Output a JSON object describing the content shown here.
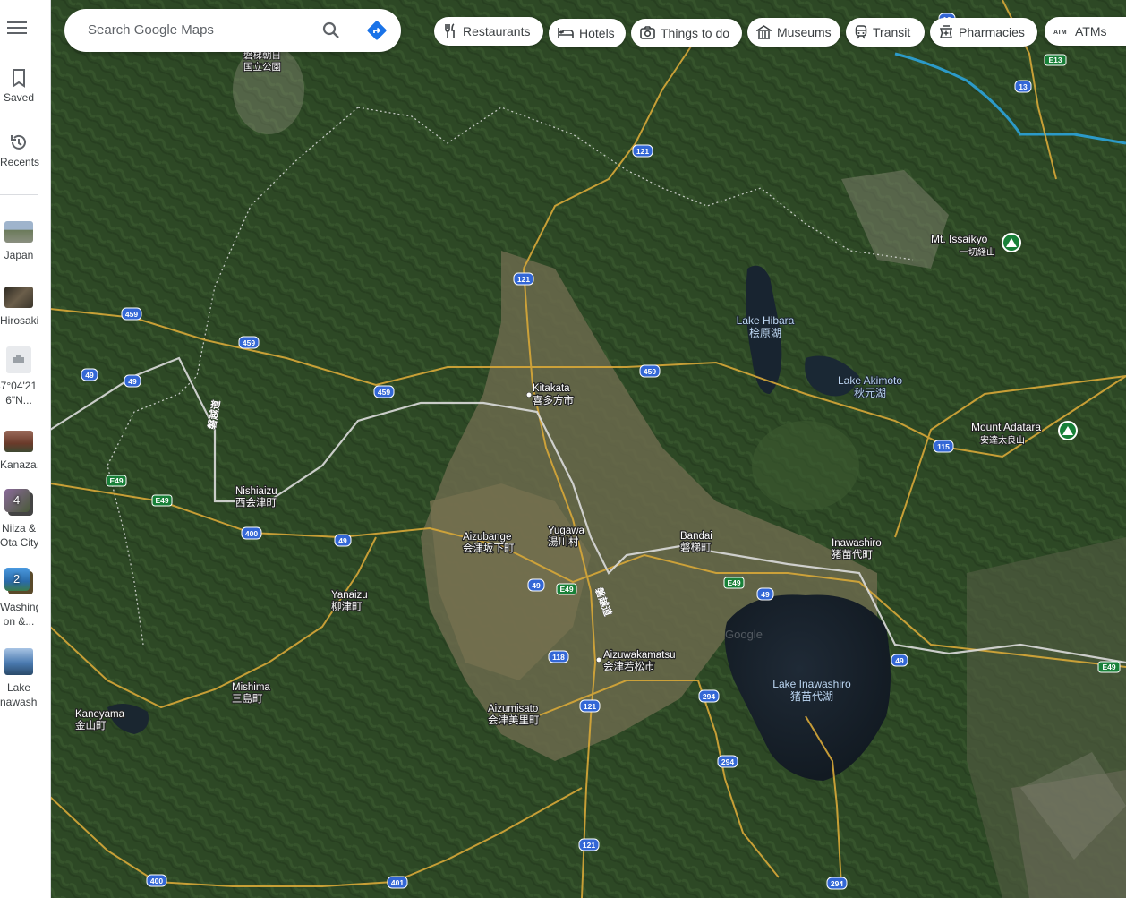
{
  "search": {
    "placeholder": "Search Google Maps"
  },
  "rail": {
    "saved_label": "Saved",
    "recents_label": "Recents",
    "items": [
      {
        "label": "Japan",
        "color": "#7a8fa8"
      },
      {
        "label": "Hirosaki",
        "color": "#4a4034"
      },
      {
        "label": "37°04'21.6\"N...",
        "line1": "37°04'21.",
        "line2": "6\"N..."
      },
      {
        "label": "Kanaza...",
        "color": "#7a4a3a"
      },
      {
        "label": "Niiza & Ota City",
        "line1": "Niiza &",
        "line2": "Ota City",
        "count": "4",
        "color": "#6a5a7a"
      },
      {
        "label": "Washington &...",
        "line1": "Washingt",
        "line2": "on &...",
        "count": "2",
        "color": "#3a7ab8"
      },
      {
        "label": "Lake Inawash...",
        "line1": "Lake",
        "line2": "nawash...",
        "color": "#5a88b8"
      }
    ]
  },
  "chips": [
    {
      "label": "Restaurants",
      "icon": "fork-knife-icon"
    },
    {
      "label": "Hotels",
      "icon": "bed-icon"
    },
    {
      "label": "Things to do",
      "icon": "camera-icon"
    },
    {
      "label": "Museums",
      "icon": "museum-icon"
    },
    {
      "label": "Transit",
      "icon": "train-icon"
    },
    {
      "label": "Pharmacies",
      "icon": "pharmacy-icon"
    },
    {
      "label": "ATMs",
      "icon": "atm-icon"
    }
  ],
  "map": {
    "places": [
      {
        "en": "Kitakata",
        "ja": "喜多方市"
      },
      {
        "en": "Nishiaizu",
        "ja": "西会津町"
      },
      {
        "en": "Aizubange",
        "ja": "会津坂下町"
      },
      {
        "en": "Yugawa",
        "ja": "湯川村"
      },
      {
        "en": "Bandai",
        "ja": "磐梯町"
      },
      {
        "en": "Inawashiro",
        "ja": "猪苗代町"
      },
      {
        "en": "Yanaizu",
        "ja": "柳津町"
      },
      {
        "en": "Aizuwakamatsu",
        "ja": "会津若松市"
      },
      {
        "en": "Aizumisato",
        "ja": "会津美里町"
      },
      {
        "en": "Mishima",
        "ja": "三島町"
      },
      {
        "en": "Kaneyama",
        "ja": "金山町"
      }
    ],
    "lakes": [
      {
        "en": "Lake Hibara",
        "ja": "桧原湖"
      },
      {
        "en": "Lake Akimoto",
        "ja": "秋元湖"
      },
      {
        "en": "Lake Inawashiro",
        "ja": "猪苗代湖"
      }
    ],
    "peaks": [
      {
        "en": "Mt. Issaikyo",
        "ja": "一切経山"
      },
      {
        "en": "Mount Adatara",
        "ja": "安達太良山"
      }
    ],
    "park": {
      "line1": "磐梯朝日",
      "line2": "国立公園"
    },
    "expressway_text": "磐越道",
    "shields": [
      "121",
      "121",
      "121",
      "121",
      "459",
      "459",
      "459",
      "459",
      "49",
      "49",
      "49",
      "49",
      "49",
      "49",
      "400",
      "400",
      "401",
      "118",
      "294",
      "294",
      "294",
      "115",
      "13",
      "13",
      "E13",
      "E49",
      "E49",
      "E49",
      "E49",
      "E49"
    ],
    "watermark": "Google"
  }
}
